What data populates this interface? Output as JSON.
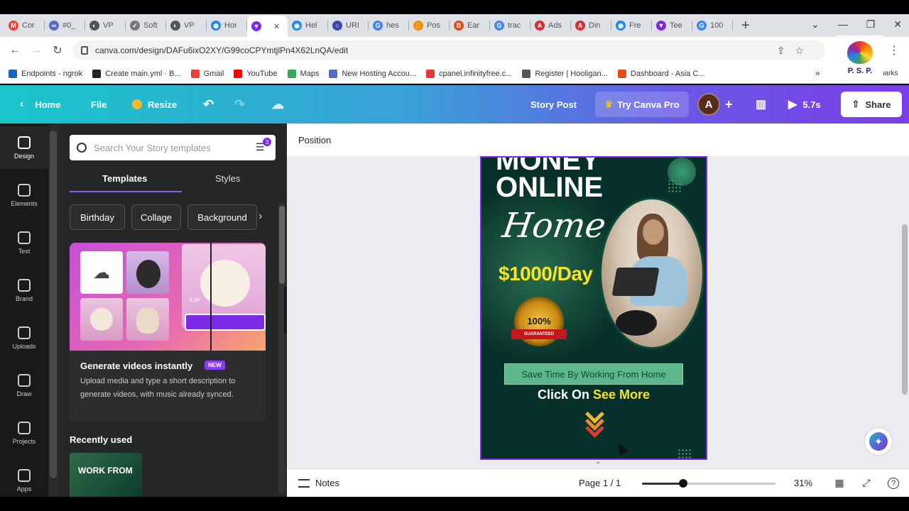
{
  "browser": {
    "tabs": [
      {
        "title": "Cor",
        "color": "#ea4335",
        "glyph": "M"
      },
      {
        "title": "#0_",
        "color": "#5c6bc0",
        "glyph": "∞"
      },
      {
        "title": "VP",
        "color": "#555555",
        "glyph": "◐"
      },
      {
        "title": "Soft",
        "color": "#777777",
        "glyph": "✓"
      },
      {
        "title": "VP",
        "color": "#555555",
        "glyph": "◐"
      },
      {
        "title": "Hor",
        "color": "#1e88e5",
        "glyph": "◉"
      },
      {
        "title": "",
        "color": "#7d2ae8",
        "glyph": "▼",
        "active": true
      },
      {
        "title": "Hel",
        "color": "#1e88e5",
        "glyph": "◉"
      },
      {
        "title": "URI",
        "color": "#3949ab",
        "glyph": "○"
      },
      {
        "title": "hes",
        "color": "#4285f4",
        "glyph": "G"
      },
      {
        "title": "Pos",
        "color": "#fb8c00",
        "glyph": "□"
      },
      {
        "title": "Ear",
        "color": "#e64a19",
        "glyph": "B"
      },
      {
        "title": "trac",
        "color": "#4285f4",
        "glyph": "G"
      },
      {
        "title": "Ads",
        "color": "#d32f2f",
        "glyph": "A"
      },
      {
        "title": "Din",
        "color": "#d32f2f",
        "glyph": "A"
      },
      {
        "title": "Fre",
        "color": "#1e88e5",
        "glyph": "◉"
      },
      {
        "title": "Tee",
        "color": "#7d2ae8",
        "glyph": "▼"
      },
      {
        "title": "100",
        "color": "#4285f4",
        "glyph": "G"
      }
    ],
    "close_glyph": "✕",
    "new_tab_glyph": "+",
    "window_controls": [
      "⌄",
      "—",
      "❐",
      "✕"
    ],
    "url": "canva.com/design/DAFu6ixO2XY/G99coCPYmtjlPn4X62LnQA/edit",
    "bookmarks": [
      {
        "label": "Endpoints - ngrok",
        "color": "#1565c0"
      },
      {
        "label": "Create main.yml · B...",
        "color": "#222222"
      },
      {
        "label": "Gmail",
        "color": "#ea4335"
      },
      {
        "label": "YouTube",
        "color": "#ff0000"
      },
      {
        "label": "Maps",
        "color": "#34a853"
      },
      {
        "label": "New Hosting Accou...",
        "color": "#5c6bc0"
      },
      {
        "label": "cpanel.infinityfree.c...",
        "color": "#e53935"
      },
      {
        "label": "Register | Hooligan...",
        "color": "#555555"
      },
      {
        "label": "Dashboard - Asia C...",
        "color": "#e64a19"
      }
    ],
    "bookmarks_overflow": "»",
    "profile_text": "P. S. P.",
    "other_bookmarks_partial": "harks"
  },
  "canva_header": {
    "home": "Home",
    "file": "File",
    "resize": "Resize",
    "doc_type": "Story Post",
    "try_pro": "Try Canva Pro",
    "avatar_letter": "A",
    "add_glyph": "+",
    "play_time": "5.7s",
    "share": "Share"
  },
  "rail": [
    {
      "label": "Design",
      "active": true
    },
    {
      "label": "Elements"
    },
    {
      "label": "Text"
    },
    {
      "label": "Brand"
    },
    {
      "label": "Uploads"
    },
    {
      "label": "Draw"
    },
    {
      "label": "Projects"
    },
    {
      "label": "Apps"
    }
  ],
  "panel": {
    "search_placeholder": "Search Your Story templates",
    "filter_count": "3",
    "tabs": [
      "Templates",
      "Styles"
    ],
    "chips": [
      "Birthday",
      "Collage",
      "Background"
    ],
    "promo_title": "Generate videos instantly",
    "promo_badge": "NEW",
    "promo_desc": "Upload media and type a short description to generate videos, with music already synced.",
    "promo_duration": "4.0s",
    "recent_label": "Recently used",
    "recent_thumb_text": "WORK FROM"
  },
  "editor": {
    "position_label": "Position",
    "design": {
      "line1": "MONEY",
      "line2": "ONLINE",
      "script": "Home",
      "price": "$1000/Day",
      "seal_text": "100%",
      "seal_ribbon": "GUARANTEED",
      "save_bar": "Save Time By Working From Home",
      "click_prefix": "Click On",
      "click_highlight": "See More"
    },
    "notes": "Notes",
    "page_indicator": "Page 1 / 1",
    "zoom_value": "31%",
    "zoom_fraction": 0.31
  },
  "colors": {
    "canva_purple": "#7d2ae8",
    "design_bg": "#07302a",
    "price_yellow": "#f7e51e"
  }
}
